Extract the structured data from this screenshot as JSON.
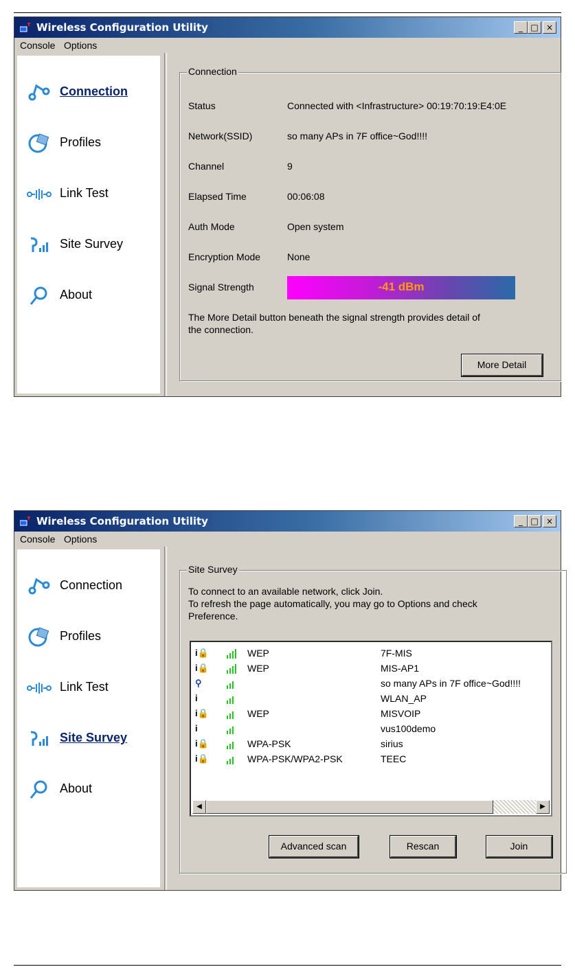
{
  "window_title": "Wireless Configuration Utility",
  "window_controls": [
    "_",
    "□",
    "×"
  ],
  "menu": [
    "Console",
    "Options"
  ],
  "nav": [
    {
      "label": "Connection",
      "icon": "connection-icon"
    },
    {
      "label": "Profiles",
      "icon": "profiles-icon"
    },
    {
      "label": "Link Test",
      "icon": "link-test-icon"
    },
    {
      "label": "Site Survey",
      "icon": "site-survey-icon"
    },
    {
      "label": "About",
      "icon": "about-icon"
    }
  ],
  "connection_screen": {
    "active_nav": "Connection",
    "group_title": "Connection",
    "status_label": "Status",
    "status_value": "Connected with <Infrastructure> 00:19:70:19:E4:0E",
    "ssid_label": "Network(SSID)",
    "ssid_value": "so many APs in 7F office~God!!!!",
    "channel_label": "Channel",
    "channel_value": "9",
    "elapsed_label": "Elapsed Time",
    "elapsed_value": "00:06:08",
    "auth_label": "Auth Mode",
    "auth_value": "Open system",
    "enc_label": "Encryption Mode",
    "enc_value": "None",
    "signal_label": "Signal Strength",
    "signal_value": "-41 dBm",
    "note_line1": "The More Detail button beneath the signal strength provides detail of",
    "note_line2": "the connection.",
    "more_detail_button": "More Detail"
  },
  "site_survey_screen": {
    "active_nav": "Site Survey",
    "group_title": "Site Survey",
    "instruction_line1": "To connect to an available network, click Join.",
    "instruction_line2": "To refresh the page automatically, you may go to Options and check",
    "instruction_line3": "Preference.",
    "access_points": [
      {
        "icon": "infrastructure-lock-icon",
        "icon_glyph": "i🔒",
        "security": "WEP",
        "ssid": "7F-MIS",
        "bars": 4
      },
      {
        "icon": "infrastructure-lock-icon",
        "icon_glyph": "i🔒",
        "security": "WEP",
        "ssid": "MIS-AP1",
        "bars": 4
      },
      {
        "icon": "connected-ap-icon",
        "icon_glyph": "⚲",
        "security": "",
        "ssid": "so many APs in 7F office~God!!!!",
        "bars": 3
      },
      {
        "icon": "infrastructure-icon",
        "icon_glyph": "i",
        "security": "",
        "ssid": "WLAN_AP",
        "bars": 3
      },
      {
        "icon": "infrastructure-lock-icon",
        "icon_glyph": "i🔒",
        "security": "WEP",
        "ssid": "MISVOIP",
        "bars": 3
      },
      {
        "icon": "infrastructure-icon",
        "icon_glyph": "i",
        "security": "",
        "ssid": "vus100demo",
        "bars": 3
      },
      {
        "icon": "infrastructure-lock-icon",
        "icon_glyph": "i🔒",
        "security": "WPA-PSK",
        "ssid": "sirius",
        "bars": 3
      },
      {
        "icon": "infrastructure-lock-icon",
        "icon_glyph": "i🔒",
        "security": "WPA-PSK/WPA2-PSK",
        "ssid": "TEEC",
        "bars": 3
      }
    ],
    "scroll_left": "◀",
    "scroll_right": "▶",
    "advanced_scan_button": "Advanced scan",
    "rescan_button": "Rescan",
    "join_button": "Join"
  },
  "colors": {
    "bars": "#22c51e",
    "active_nav": "#0a246a",
    "signal_text": "#ff9a00"
  }
}
